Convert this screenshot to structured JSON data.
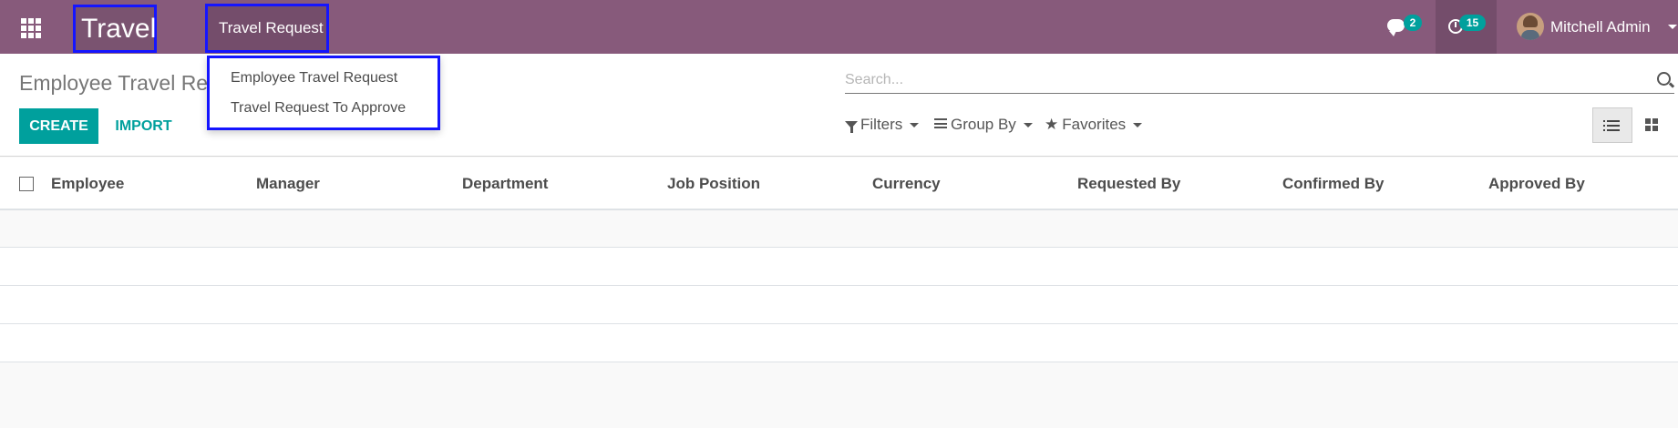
{
  "navbar": {
    "apps_icon": "grid-icon",
    "brand": "Travel",
    "menu": "Travel Request",
    "messages_count": "2",
    "activities_count": "15",
    "user_name": "Mitchell Admin",
    "bg_color": "#875a7b"
  },
  "dropdown": {
    "items": [
      "Employee Travel Request",
      "Travel Request To Approve"
    ]
  },
  "control_panel": {
    "breadcrumb": "Employee Travel Request",
    "create_label": "CREATE",
    "import_label": "IMPORT",
    "search_placeholder": "Search...",
    "filters_label": "Filters",
    "groupby_label": "Group By",
    "favorites_label": "Favorites",
    "accent_color": "#00a09d"
  },
  "table": {
    "columns": [
      "Employee",
      "Manager",
      "Department",
      "Job Position",
      "Currency",
      "Requested By",
      "Confirmed By",
      "Approved By"
    ]
  }
}
